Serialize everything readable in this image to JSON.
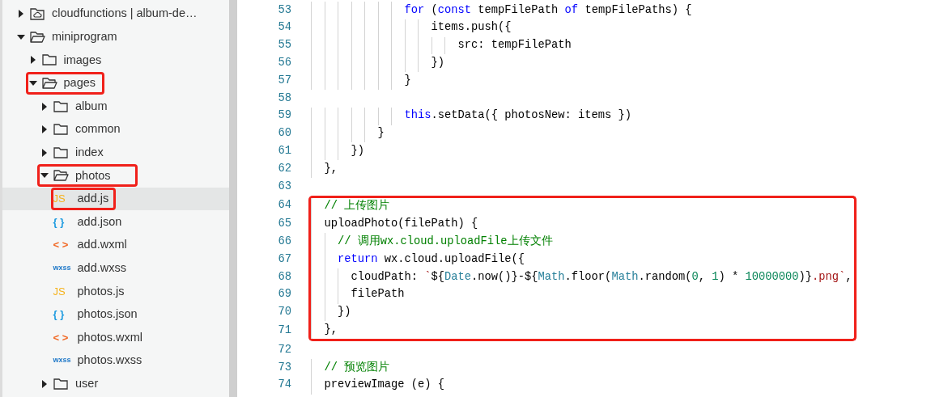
{
  "file_tree": [
    {
      "label": "cloudfunctions | album-de…",
      "kind": "cloud-folder",
      "expanded": false,
      "selected": false,
      "highlighted": false
    },
    {
      "label": "miniprogram",
      "kind": "folder",
      "expanded": true,
      "selected": false,
      "highlighted": false,
      "children": [
        {
          "label": "images",
          "kind": "folder",
          "expanded": false,
          "selected": false,
          "highlighted": false
        },
        {
          "label": "pages",
          "kind": "folder",
          "expanded": true,
          "selected": false,
          "highlighted": true,
          "children": [
            {
              "label": "album",
              "kind": "folder",
              "expanded": false,
              "selected": false,
              "highlighted": false
            },
            {
              "label": "common",
              "kind": "folder",
              "expanded": false,
              "selected": false,
              "highlighted": false
            },
            {
              "label": "index",
              "kind": "folder",
              "expanded": false,
              "selected": false,
              "highlighted": false
            },
            {
              "label": "photos",
              "kind": "folder",
              "expanded": true,
              "selected": false,
              "highlighted": true,
              "children": [
                {
                  "label": "add.js",
                  "kind": "js",
                  "icon": "JS",
                  "selected": true,
                  "highlighted": true
                },
                {
                  "label": "add.json",
                  "kind": "json",
                  "icon": "{ }",
                  "selected": false,
                  "highlighted": false
                },
                {
                  "label": "add.wxml",
                  "kind": "wxml",
                  "icon": "< >",
                  "selected": false,
                  "highlighted": false
                },
                {
                  "label": "add.wxss",
                  "kind": "wxss",
                  "icon": "wxss",
                  "selected": false,
                  "highlighted": false
                },
                {
                  "label": "photos.js",
                  "kind": "js",
                  "icon": "JS",
                  "selected": false,
                  "highlighted": false
                },
                {
                  "label": "photos.json",
                  "kind": "json",
                  "icon": "{ }",
                  "selected": false,
                  "highlighted": false
                },
                {
                  "label": "photos.wxml",
                  "kind": "wxml",
                  "icon": "< >",
                  "selected": false,
                  "highlighted": false
                },
                {
                  "label": "photos.wxss",
                  "kind": "wxss",
                  "icon": "wxss",
                  "selected": false,
                  "highlighted": false
                }
              ]
            },
            {
              "label": "user",
              "kind": "folder",
              "expanded": false,
              "selected": false,
              "highlighted": false
            }
          ]
        }
      ]
    }
  ],
  "code_lines": [
    {
      "number": "53",
      "highlighted": false,
      "tokens": [
        {
          "kind": "keyword",
          "text": "              for"
        },
        {
          "kind": "plain",
          "text": " ("
        },
        {
          "kind": "keyword",
          "text": "const"
        },
        {
          "kind": "plain",
          "text": " tempFilePath "
        },
        {
          "kind": "keyword",
          "text": "of"
        },
        {
          "kind": "plain",
          "text": " tempFilePaths) {"
        }
      ]
    },
    {
      "number": "54",
      "highlighted": false,
      "tokens": [
        {
          "kind": "plain",
          "text": "                  items.push({"
        }
      ]
    },
    {
      "number": "55",
      "highlighted": false,
      "tokens": [
        {
          "kind": "plain",
          "text": "                      src: tempFilePath"
        }
      ]
    },
    {
      "number": "56",
      "highlighted": false,
      "tokens": [
        {
          "kind": "plain",
          "text": "                  })"
        }
      ]
    },
    {
      "number": "57",
      "highlighted": false,
      "tokens": [
        {
          "kind": "plain",
          "text": "              }"
        }
      ]
    },
    {
      "number": "58",
      "highlighted": false
    },
    {
      "number": "59",
      "highlighted": false,
      "tokens": [
        {
          "kind": "keyword",
          "text": "              this"
        },
        {
          "kind": "plain",
          "text": ".setData({ photosNew: items })"
        }
      ]
    },
    {
      "number": "60",
      "highlighted": false,
      "tokens": [
        {
          "kind": "plain",
          "text": "          }"
        }
      ]
    },
    {
      "number": "61",
      "highlighted": false,
      "tokens": [
        {
          "kind": "plain",
          "text": "      })"
        }
      ]
    },
    {
      "number": "62",
      "highlighted": false,
      "tokens": [
        {
          "kind": "plain",
          "text": "  },"
        }
      ]
    },
    {
      "number": "63",
      "highlighted": false
    },
    {
      "number": "64",
      "highlighted": true,
      "tokens": [
        {
          "kind": "comment",
          "text": "  // 上传图片"
        }
      ]
    },
    {
      "number": "65",
      "highlighted": true,
      "tokens": [
        {
          "kind": "plain",
          "text": "  uploadPhoto(filePath) {"
        }
      ]
    },
    {
      "number": "66",
      "highlighted": true,
      "tokens": [
        {
          "kind": "comment",
          "text": "    // 调用wx.cloud.uploadFile上传文件"
        }
      ]
    },
    {
      "number": "67",
      "highlighted": true,
      "tokens": [
        {
          "kind": "keyword",
          "text": "    return"
        },
        {
          "kind": "plain",
          "text": " wx.cloud.uploadFile({"
        }
      ]
    },
    {
      "number": "68",
      "highlighted": true,
      "tokens": [
        {
          "kind": "plain",
          "text": "      cloudPath: "
        },
        {
          "kind": "string",
          "text": "`"
        },
        {
          "kind": "plain",
          "text": "${"
        },
        {
          "kind": "type",
          "text": "Date"
        },
        {
          "kind": "plain",
          "text": ".now()}-${"
        },
        {
          "kind": "type",
          "text": "Math"
        },
        {
          "kind": "plain",
          "text": ".floor("
        },
        {
          "kind": "type",
          "text": "Math"
        },
        {
          "kind": "plain",
          "text": ".random("
        },
        {
          "kind": "number",
          "text": "0"
        },
        {
          "kind": "plain",
          "text": ", "
        },
        {
          "kind": "number",
          "text": "1"
        },
        {
          "kind": "plain",
          "text": ") * "
        },
        {
          "kind": "number",
          "text": "10000000"
        },
        {
          "kind": "plain",
          "text": ")}"
        },
        {
          "kind": "string",
          "text": ".png`"
        },
        {
          "kind": "plain",
          "text": ","
        }
      ]
    },
    {
      "number": "69",
      "highlighted": true,
      "tokens": [
        {
          "kind": "plain",
          "text": "      filePath"
        }
      ]
    },
    {
      "number": "70",
      "highlighted": true,
      "tokens": [
        {
          "kind": "plain",
          "text": "    })"
        }
      ]
    },
    {
      "number": "71",
      "highlighted": true,
      "tokens": [
        {
          "kind": "plain",
          "text": "  },"
        }
      ]
    },
    {
      "number": "72",
      "highlighted": false
    },
    {
      "number": "73",
      "highlighted": false,
      "tokens": [
        {
          "kind": "comment",
          "text": "  // 预览图片"
        }
      ]
    },
    {
      "number": "74",
      "highlighted": false,
      "tokens": [
        {
          "kind": "plain",
          "text": "  previewImage (e) {"
        }
      ]
    }
  ]
}
